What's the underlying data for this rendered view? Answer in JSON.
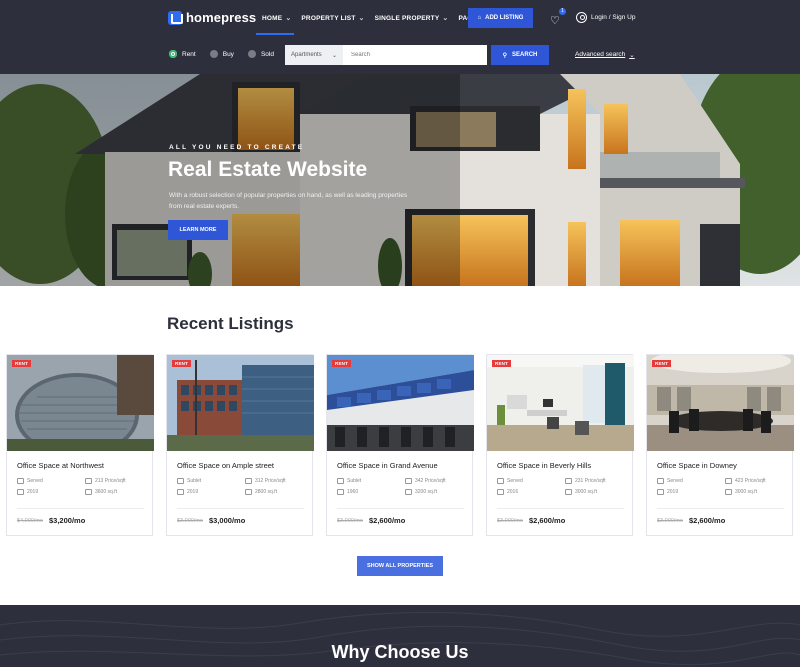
{
  "header": {
    "logo": "homepress",
    "nav": [
      {
        "label": "HOME",
        "active": true
      },
      {
        "label": "PROPERTY LIST"
      },
      {
        "label": "SINGLE PROPERTY"
      },
      {
        "label": "PAGES"
      }
    ],
    "add_listing": "ADD LISTING",
    "favorites_count": "1",
    "login": "Login / Sign Up"
  },
  "search": {
    "modes": [
      {
        "label": "Rent",
        "selected": true
      },
      {
        "label": "Buy",
        "selected": false
      },
      {
        "label": "Sold",
        "selected": false
      }
    ],
    "type_value": "Apartments",
    "placeholder": "Search",
    "button": "SEARCH",
    "advanced": "Advanced search"
  },
  "hero": {
    "kicker": "ALL YOU NEED TO CREATE",
    "title": "Real Estate Website",
    "description": "With a robust selection of popular properties on hand, as well as leading properties from real estate experts.",
    "button": "LEARN MORE"
  },
  "listings": {
    "title": "Recent Listings",
    "badge": "RENT",
    "cards": [
      {
        "title": "Office Space at Northwest",
        "spec1": "Served",
        "spec2": "213 Price/sqft",
        "spec3": "2019",
        "spec4": "3600 sq.ft",
        "old_price": "$4,000/mo",
        "new_price": "$3,200/mo"
      },
      {
        "title": "Office Space on Ample street",
        "spec1": "Sublet",
        "spec2": "312 Price/sqft",
        "spec3": "2019",
        "spec4": "2800 sq.ft",
        "old_price": "$3,000/mo",
        "new_price": "$3,000/mo"
      },
      {
        "title": "Office Space in Grand Avenue",
        "spec1": "Sublet",
        "spec2": "342 Price/sqft",
        "spec3": "1960",
        "spec4": "3200 sq.ft",
        "old_price": "$3,000/mo",
        "new_price": "$2,600/mo"
      },
      {
        "title": "Office Space in Beverly Hills",
        "spec1": "Served",
        "spec2": "231 Price/sqft",
        "spec3": "2016",
        "spec4": "3000 sq.ft",
        "old_price": "$3,000/mo",
        "new_price": "$2,600/mo"
      },
      {
        "title": "Office Space in Downey",
        "spec1": "Served",
        "spec2": "423 Price/sqft",
        "spec3": "2019",
        "spec4": "3000 sq.ft",
        "old_price": "$3,000/mo",
        "new_price": "$2,600/mo"
      }
    ],
    "show_all": "SHOW ALL PROPERTIES"
  },
  "why": {
    "title": "Why Choose Us"
  },
  "colors": {
    "header_bg": "#2d303c",
    "accent": "#2f56d6",
    "badge": "#e63b3b",
    "radio_on": "#3cb371"
  }
}
